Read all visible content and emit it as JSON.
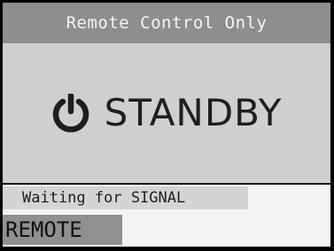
{
  "header": {
    "title": "Remote Control Only"
  },
  "status": {
    "icon": "power-icon",
    "label": "STANDBY"
  },
  "footer": {
    "signal_text": "Waiting for SIGNAL",
    "mode_label": "REMOTE"
  },
  "colors": {
    "frame": "#000000",
    "header_bg": "#8e8e8e",
    "header_text": "#f4f4f4",
    "main_bg": "#cfcfcf",
    "footer_bg": "#f3f3f3",
    "signal_bg": "#d4d4d4",
    "mode_bg": "#909090"
  }
}
